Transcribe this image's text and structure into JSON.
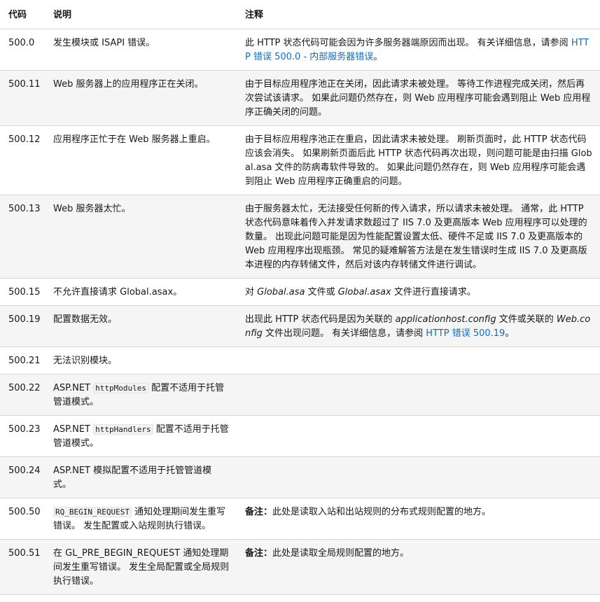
{
  "header": {
    "code": "代码",
    "description": "说明",
    "notes": "注释"
  },
  "rows": [
    {
      "code": "500.0",
      "description": "发生模块或 ISAPI 错误。",
      "notes_text": "此 HTTP 状态代码可能会因为许多服务器端原因而出现。 有关详细信息，请参阅 ",
      "notes_link": "HTTP 错误 500.0 - 内部服务器错误",
      "notes_tail": "。"
    },
    {
      "code": "500.11",
      "description": "Web 服务器上的应用程序正在关闭。",
      "notes_text": "由于目标应用程序池正在关闭，因此请求未被处理。 等待工作进程完成关闭，然后再次尝试该请求。 如果此问题仍然存在，则 Web 应用程序可能会遇到阻止 Web 应用程序正确关闭的问题。"
    },
    {
      "code": "500.12",
      "description": "应用程序正忙于在 Web 服务器上重启。",
      "notes_text": "由于目标应用程序池正在重启，因此请求未被处理。 刷新页面时，此 HTTP 状态代码应该会消失。 如果刷新页面后此 HTTP 状态代码再次出现，则问题可能是由扫描 Global.asa 文件的防病毒软件导致的。 如果此问题仍然存在，则 Web 应用程序可能会遇到阻止 Web 应用程序正确重启的问题。"
    },
    {
      "code": "500.13",
      "description": "Web 服务器太忙。",
      "notes_text": "由于服务器太忙，无法接受任何新的传入请求，所以请求未被处理。 通常，此 HTTP 状态代码意味着传入并发请求数超过了 IIS 7.0 及更高版本 Web 应用程序可以处理的数量。 出现此问题可能是因为性能配置设置太低、硬件不足或 IIS 7.0 及更高版本的 Web 应用程序出现瓶颈。 常见的疑难解答方法是在发生错误时生成 IIS 7.0 及更高版本进程的内存转储文件，然后对该内存转储文件进行调试。"
    },
    {
      "code": "500.15",
      "description": "不允许直接请求 Global.asax。",
      "notes_pre": "对 ",
      "notes_em1": "Global.asa",
      "notes_mid": " 文件或 ",
      "notes_em2": "Global.asax",
      "notes_post": " 文件进行直接请求。"
    },
    {
      "code": "500.19",
      "description": "配置数据无效。",
      "notes_pre": "出现此 HTTP 状态代码是因为关联的 ",
      "notes_em1": "applicationhost.config",
      "notes_mid": " 文件或关联的 ",
      "notes_em2": "Web.config",
      "notes_post": " 文件出现问题。 有关详细信息，请参阅 ",
      "notes_link": "HTTP 错误 500.19",
      "notes_tail": "。"
    },
    {
      "code": "500.21",
      "description": "无法识别模块。"
    },
    {
      "code": "500.22",
      "description_pre": "ASP.NET ",
      "description_code": "httpModules",
      "description_post": " 配置不适用于托管管道模式。"
    },
    {
      "code": "500.23",
      "description_pre": "ASP.NET ",
      "description_code": "httpHandlers",
      "description_post": " 配置不适用于托管管道模式。"
    },
    {
      "code": "500.24",
      "description": "ASP.NET 模拟配置不适用于托管管道模式。"
    },
    {
      "code": "500.50",
      "description_code": "RQ_BEGIN_REQUEST",
      "description_post": " 通知处理期间发生重写错误。 发生配置或入站规则执行错误。",
      "notes_strong": "备注：",
      "notes_text": "此处是读取入站和出站规则的分布式规则配置的地方。"
    },
    {
      "code": "500.51",
      "description": "在 GL_PRE_BEGIN_REQUEST 通知处理期间发生重写错误。 发生全局配置或全局规则执行错误。",
      "notes_strong": "备注：",
      "notes_text": "此处是读取全局规则配置的地方。"
    }
  ],
  "colors": {
    "link": "#0f6cbd",
    "row_stripe": "#f5f5f5",
    "border": "#d6d6d6",
    "text": "#171717"
  }
}
